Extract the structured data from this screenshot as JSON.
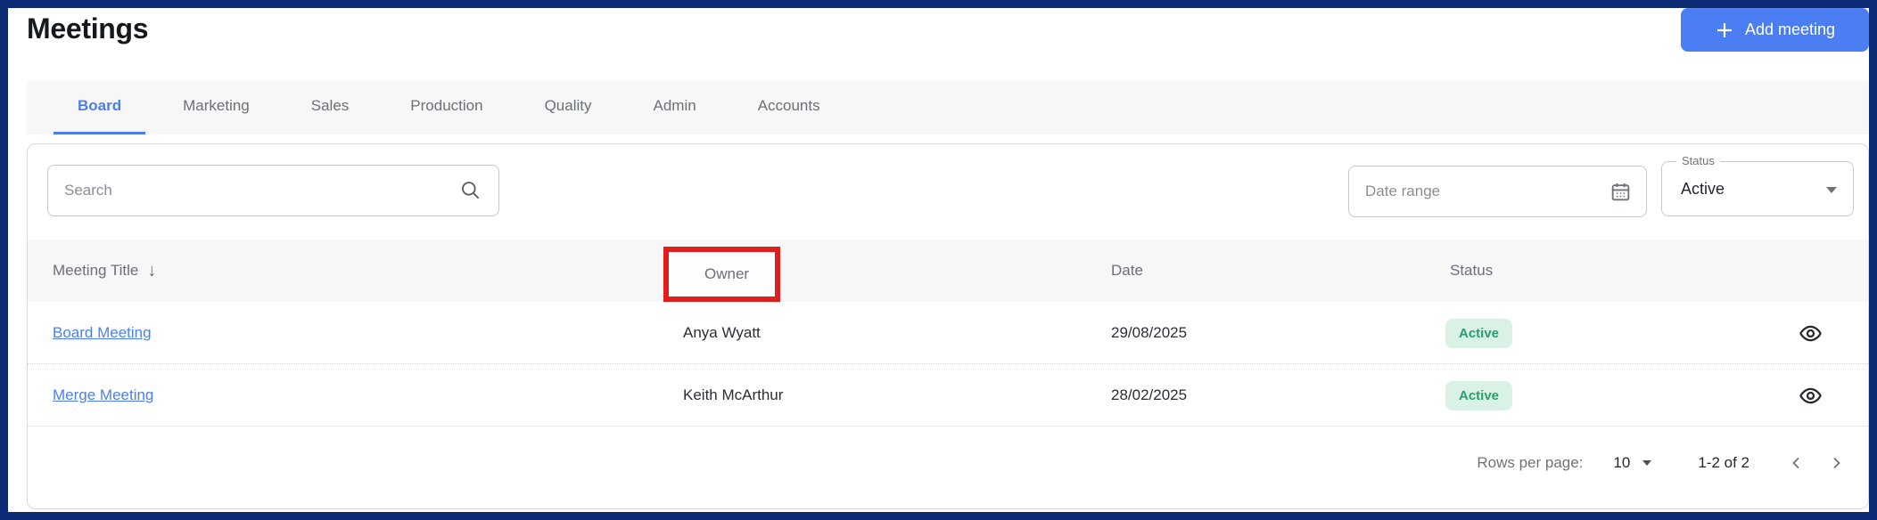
{
  "page": {
    "title": "Meetings"
  },
  "colors": {
    "frame_border": "#0d2a74",
    "accent_blue": "#4c7ef3",
    "badge_bg": "#daf2e6",
    "badge_text": "#27a06a",
    "annotation_red": "#e01e1e",
    "bar_bg": "#f7f7f8"
  },
  "header": {
    "add_button": {
      "label": "Add meeting",
      "icon": "plus-icon"
    }
  },
  "tabs": [
    {
      "label": "Board",
      "active": true
    },
    {
      "label": "Marketing",
      "active": false
    },
    {
      "label": "Sales",
      "active": false
    },
    {
      "label": "Production",
      "active": false
    },
    {
      "label": "Quality",
      "active": false
    },
    {
      "label": "Admin",
      "active": false
    },
    {
      "label": "Accounts",
      "active": false
    }
  ],
  "filters": {
    "search": {
      "placeholder": "Search",
      "value": "",
      "icon": "search-icon"
    },
    "date_range": {
      "placeholder": "Date range",
      "value": "",
      "icon": "calendar-icon"
    },
    "status": {
      "label": "Status",
      "value": "Active",
      "icon": "dropdown-triangle-icon"
    }
  },
  "table": {
    "columns": {
      "title": {
        "label": "Meeting Title",
        "sort": "desc",
        "sort_icon": "arrow-down-icon"
      },
      "owner": {
        "label": "Owner",
        "annotated": true
      },
      "date": {
        "label": "Date"
      },
      "status": {
        "label": "Status"
      }
    },
    "rows": [
      {
        "title": "Board Meeting",
        "owner": "Anya Wyatt",
        "date": "29/08/2025",
        "status": "Active",
        "action_icon": "eye-icon"
      },
      {
        "title": "Merge Meeting",
        "owner": "Keith McArthur",
        "date": "28/02/2025",
        "status": "Active",
        "action_icon": "eye-icon"
      }
    ]
  },
  "pagination": {
    "rows_per_page_label": "Rows per page:",
    "rows_per_page_value": "10",
    "range_label": "1-2 of 2",
    "icons": [
      "dropdown-caret-icon",
      "chevron-left-icon",
      "chevron-right-icon"
    ]
  },
  "icons_glyphs": {
    "sort_desc": "↓"
  }
}
